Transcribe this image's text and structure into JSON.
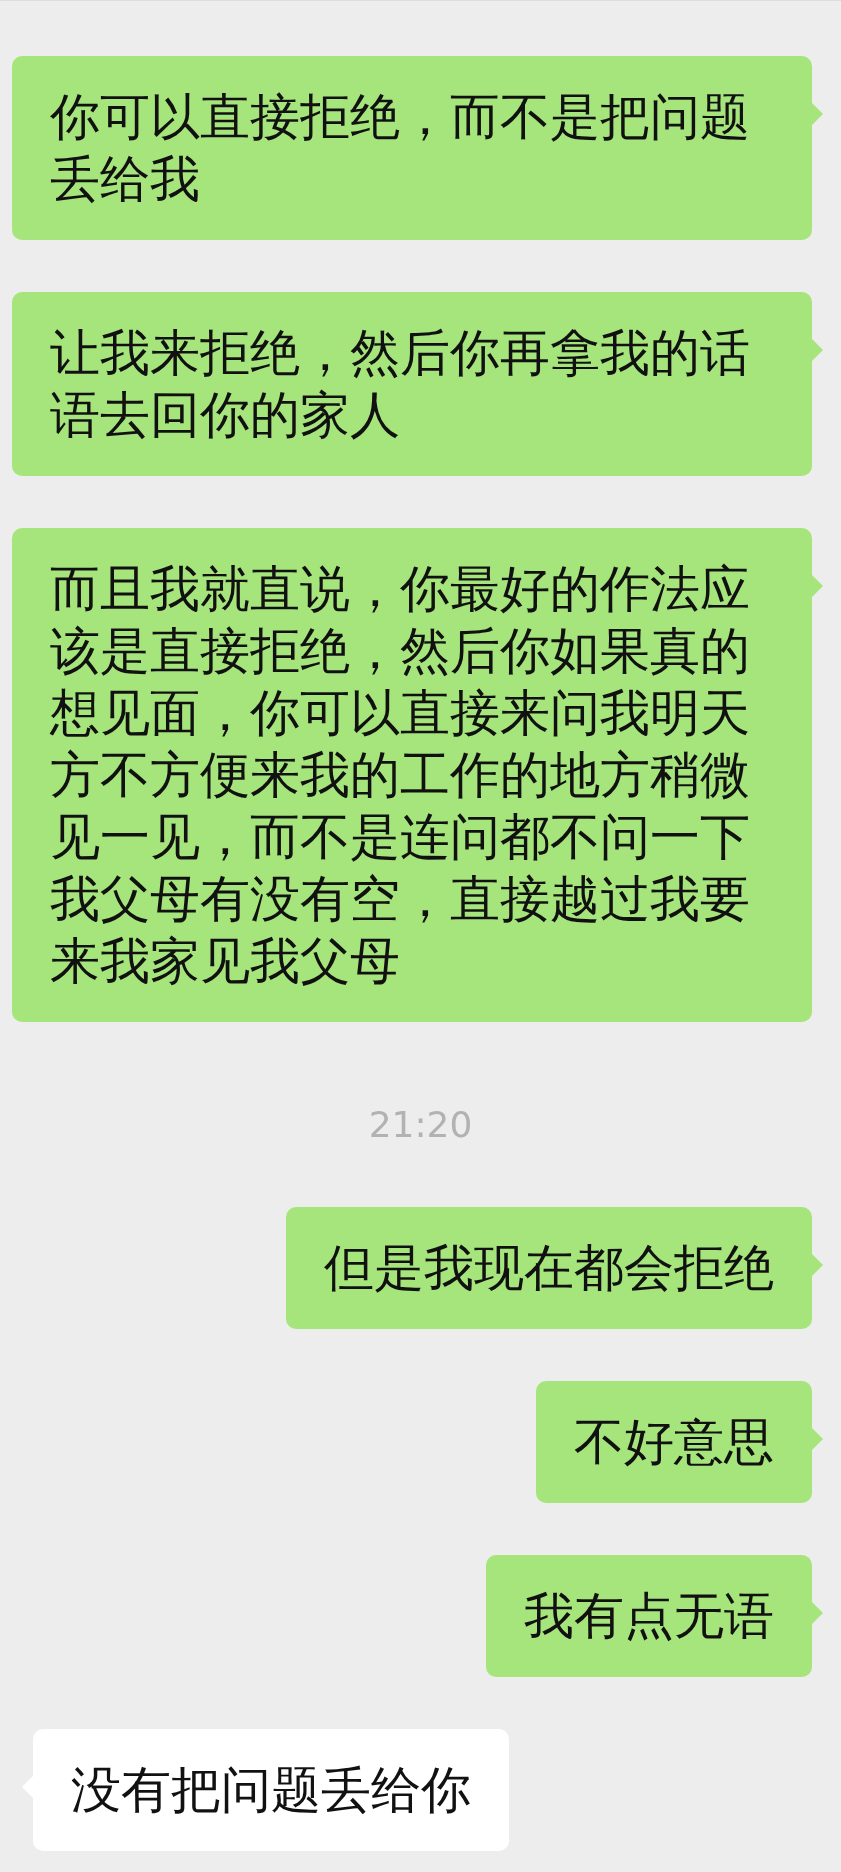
{
  "messages": [
    {
      "kind": "sent",
      "text": "你可以直接拒绝，而不是把问题丢给我"
    },
    {
      "kind": "sent",
      "text": "让我来拒绝，然后你再拿我的话语去回你的家人"
    },
    {
      "kind": "sent",
      "text": "而且我就直说，你最好的作法应该是直接拒绝，然后你如果真的想见面，你可以直接来问我明天方不方便来我的工作的地方稍微见一见，而不是连问都不问一下我父母有没有空，直接越过我要来我家见我父母"
    },
    {
      "kind": "timestamp",
      "text": "21:20"
    },
    {
      "kind": "sent",
      "text": "但是我现在都会拒绝"
    },
    {
      "kind": "sent",
      "text": "不好意思"
    },
    {
      "kind": "sent",
      "text": "我有点无语"
    },
    {
      "kind": "received",
      "text": "没有把问题丢给你"
    }
  ]
}
